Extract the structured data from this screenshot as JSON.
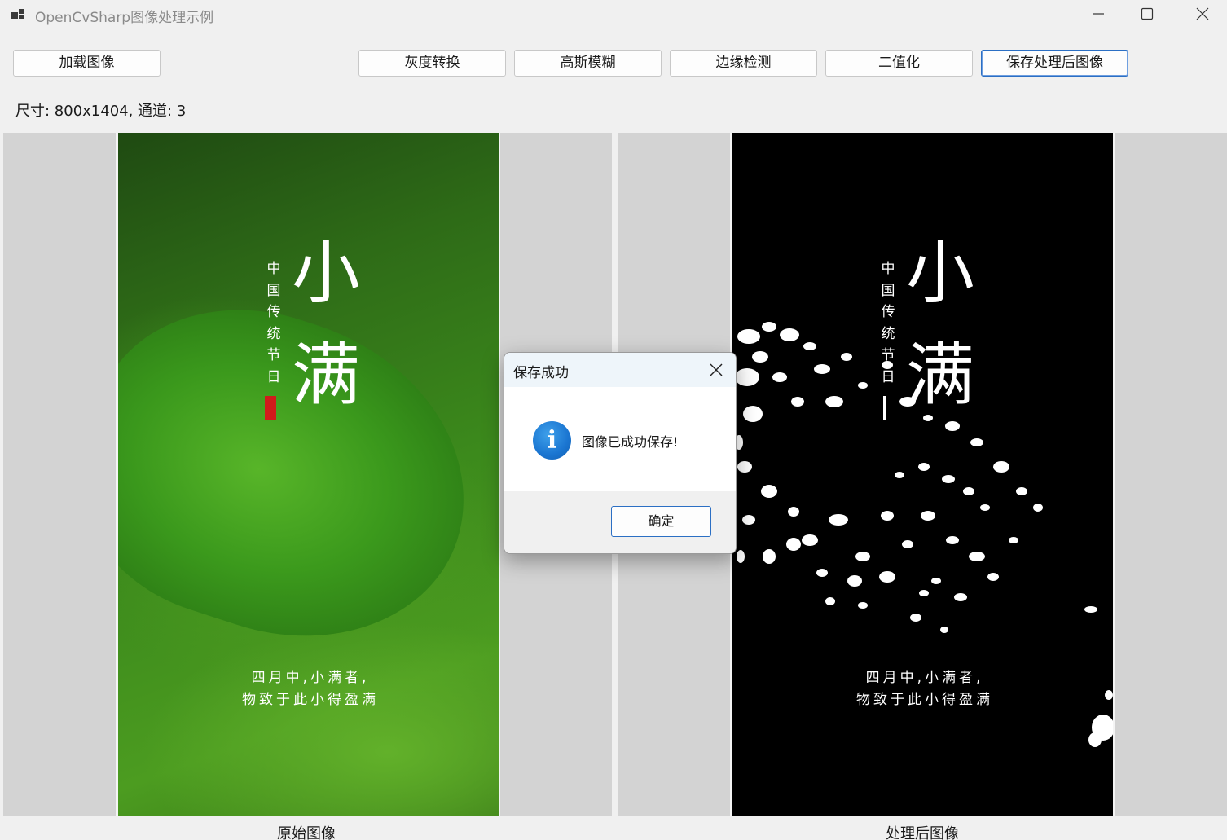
{
  "window": {
    "title": "OpenCvSharp图像处理示例",
    "controls": [
      "minimize",
      "maximize",
      "close"
    ]
  },
  "toolbar": {
    "load_label": "加载图像",
    "gray_label": "灰度转换",
    "blur_label": "高斯模糊",
    "edge_label": "边缘检测",
    "binary_label": "二值化",
    "save_label": "保存处理后图像"
  },
  "info": {
    "size_text": "尺寸: 800x1404, 通道: 3"
  },
  "poster": {
    "title_char1": "小",
    "title_char2": "满",
    "vertical_text": "中国传统节日",
    "line1": "四月中,小满者,",
    "line2": "物致于此小得盈满"
  },
  "captions": {
    "original": "原始图像",
    "processed": "处理后图像"
  },
  "dialog": {
    "title": "保存成功",
    "message": "图像已成功保存!",
    "icon": "info-icon",
    "ok_label": "确定"
  },
  "colors": {
    "accent": "#2b6fc4",
    "window_bg": "#f0f0f0",
    "panel_bg": "#d3d3d3",
    "info_icon": "#1a75d1",
    "seal": "#d11b1b"
  }
}
